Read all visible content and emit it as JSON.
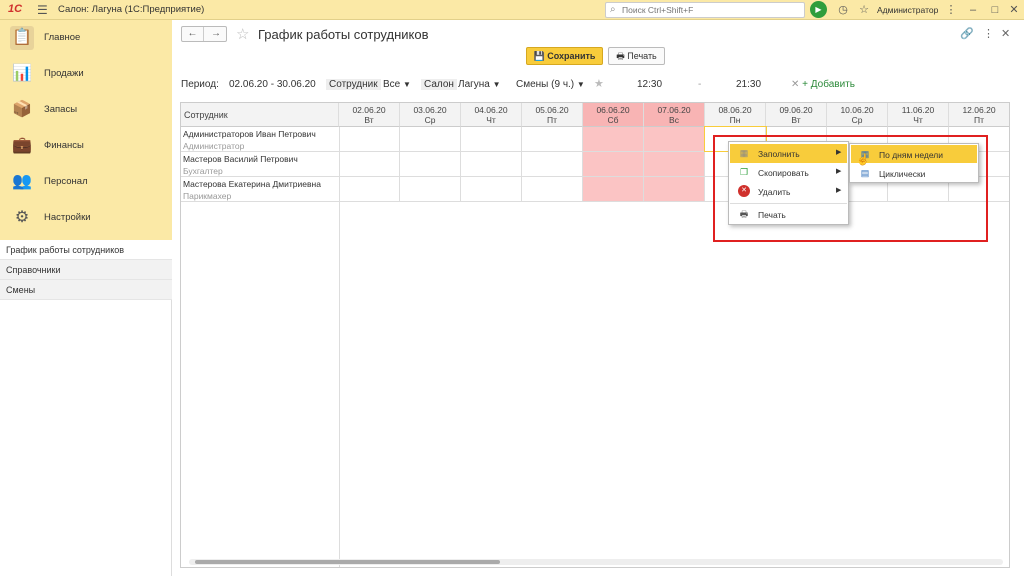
{
  "topbar": {
    "logo": "1С",
    "app_title": "Салон: Лагуна  (1С:Предприятие)",
    "search_placeholder": "Поиск Ctrl+Shift+F",
    "user": "Администратор"
  },
  "sections": [
    {
      "label": "Главное",
      "icon": "clipboard-icon"
    },
    {
      "label": "Продажи",
      "icon": "chart-icon"
    },
    {
      "label": "Запасы",
      "icon": "box-icon"
    },
    {
      "label": "Финансы",
      "icon": "wallet-icon"
    },
    {
      "label": "Персонал",
      "icon": "people-icon"
    },
    {
      "label": "Настройки",
      "icon": "gear-icon"
    }
  ],
  "nav": [
    {
      "label": "График работы сотрудников"
    },
    {
      "label": "Справочники"
    },
    {
      "label": "Смены"
    }
  ],
  "form": {
    "title": "График работы сотрудников",
    "save_label": "Сохранить",
    "print_label": "Печать"
  },
  "filters": {
    "period_label": "Период:",
    "period_value": "02.06.20 - 30.06.20",
    "employee_label": "Сотрудник",
    "employee_value": "Все",
    "salon_label": "Салон",
    "salon_value": "Лагуна",
    "shifts_value": "Смены (9 ч.)",
    "time_from": "12:30",
    "dash": "-",
    "time_to": "21:30",
    "add_label": "+ Добавить"
  },
  "table": {
    "employee_header": "Сотрудник",
    "dates": [
      {
        "date": "02.06.20",
        "day": "Вт",
        "weekend": false
      },
      {
        "date": "03.06.20",
        "day": "Ср",
        "weekend": false
      },
      {
        "date": "04.06.20",
        "day": "Чт",
        "weekend": false
      },
      {
        "date": "05.06.20",
        "day": "Пт",
        "weekend": false
      },
      {
        "date": "06.06.20",
        "day": "Сб",
        "weekend": true
      },
      {
        "date": "07.06.20",
        "day": "Вс",
        "weekend": true
      },
      {
        "date": "08.06.20",
        "day": "Пн",
        "weekend": false
      },
      {
        "date": "09.06.20",
        "day": "Вт",
        "weekend": false
      },
      {
        "date": "10.06.20",
        "day": "Ср",
        "weekend": false
      },
      {
        "date": "11.06.20",
        "day": "Чт",
        "weekend": false
      },
      {
        "date": "12.06.20",
        "day": "Пт",
        "weekend": false
      }
    ],
    "rows": [
      {
        "name": "Администраторов Иван Петрович",
        "position": "Администратор"
      },
      {
        "name": "Мастеров Василий Петрович",
        "position": "Бухгалтер"
      },
      {
        "name": "Мастерова Екатерина Дмитриевна",
        "position": "Парикмахер"
      }
    ]
  },
  "context_menu": {
    "items": [
      {
        "label": "Заполнить",
        "icon": "fill-icon",
        "submenu": true
      },
      {
        "label": "Скопировать",
        "icon": "copy-icon",
        "submenu": true
      },
      {
        "label": "Удалить",
        "icon": "delete-icon",
        "submenu": true
      },
      {
        "label": "Печать",
        "icon": "print-icon",
        "submenu": false
      }
    ],
    "submenu": [
      {
        "label": "По дням недели",
        "icon": "calendar-icon"
      },
      {
        "label": "Циклически",
        "icon": "cycle-icon"
      }
    ]
  },
  "colors": {
    "accent": "#f8cc3b",
    "sidebar_bg": "#fbe9a6",
    "weekend": "#f8b4b4",
    "highlight_box": "#e02020",
    "add_link": "#2c8a3a"
  }
}
